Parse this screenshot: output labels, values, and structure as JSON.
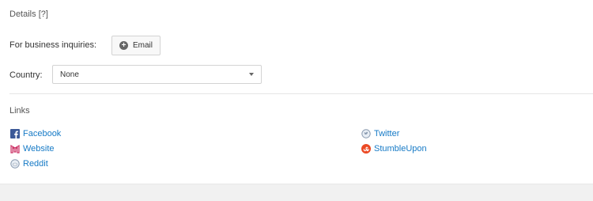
{
  "details": {
    "heading": "Details",
    "help_link": "[?]"
  },
  "business": {
    "label": "For business inquiries:",
    "email_button": "Email"
  },
  "country": {
    "label": "Country:",
    "selected": "None"
  },
  "links": {
    "heading": "Links",
    "items": [
      {
        "label": "Facebook",
        "icon": "facebook-icon"
      },
      {
        "label": "Website",
        "icon": "website-icon"
      },
      {
        "label": "Reddit",
        "icon": "reddit-icon"
      },
      {
        "label": "Twitter",
        "icon": "twitter-icon"
      },
      {
        "label": "StumbleUpon",
        "icon": "stumbleupon-icon"
      }
    ]
  },
  "colors": {
    "link": "#167ac6",
    "facebook": "#3b5998",
    "website": "#cc3366",
    "stumbleupon": "#eb4924"
  }
}
